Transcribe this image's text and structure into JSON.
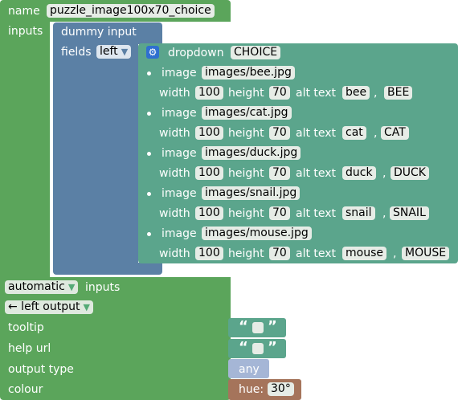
{
  "factory": {
    "name_label": "name",
    "name_value": "puzzle_image100x70_choice",
    "inputs_label": "inputs"
  },
  "dummy_input": {
    "title": "dummy input",
    "fields_label": "fields",
    "align": "left"
  },
  "dropdown": {
    "label": "dropdown",
    "name": "CHOICE",
    "options": [
      {
        "image_label": "image",
        "src": "images/bee.jpg",
        "width_label": "width",
        "width": "100",
        "height_label": "height",
        "height": "70",
        "alt_label": "alt text",
        "alt": "bee",
        "comma": ",",
        "value": "BEE"
      },
      {
        "image_label": "image",
        "src": "images/cat.jpg",
        "width_label": "width",
        "width": "100",
        "height_label": "height",
        "height": "70",
        "alt_label": "alt text",
        "alt": "cat",
        "comma": ",",
        "value": "CAT"
      },
      {
        "image_label": "image",
        "src": "images/duck.jpg",
        "width_label": "width",
        "width": "100",
        "height_label": "height",
        "height": "70",
        "alt_label": "alt text",
        "alt": "duck",
        "comma": ",",
        "value": "DUCK"
      },
      {
        "image_label": "image",
        "src": "images/snail.jpg",
        "width_label": "width",
        "width": "100",
        "height_label": "height",
        "height": "70",
        "alt_label": "alt text",
        "alt": "snail",
        "comma": ",",
        "value": "SNAIL"
      },
      {
        "image_label": "image",
        "src": "images/mouse.jpg",
        "width_label": "width",
        "width": "100",
        "height_label": "height",
        "height": "70",
        "alt_label": "alt text",
        "alt": "mouse",
        "comma": ",",
        "value": "MOUSE"
      }
    ]
  },
  "bottom": {
    "inputs_mode": "automatic",
    "inputs_label": "inputs",
    "output": "← left output",
    "tooltip_label": "tooltip",
    "help_url_label": "help url",
    "output_type_label": "output type",
    "colour_label": "colour",
    "quote_open": "“",
    "quote_close": "”",
    "type_value": "any",
    "hue_label": "hue:",
    "hue_value": "30°"
  },
  "colors": {
    "factory": "#5ba55b",
    "input": "#5b80a5",
    "field": "#5ba58c",
    "type": "#a5b6d6",
    "colour": "#a5745b"
  }
}
